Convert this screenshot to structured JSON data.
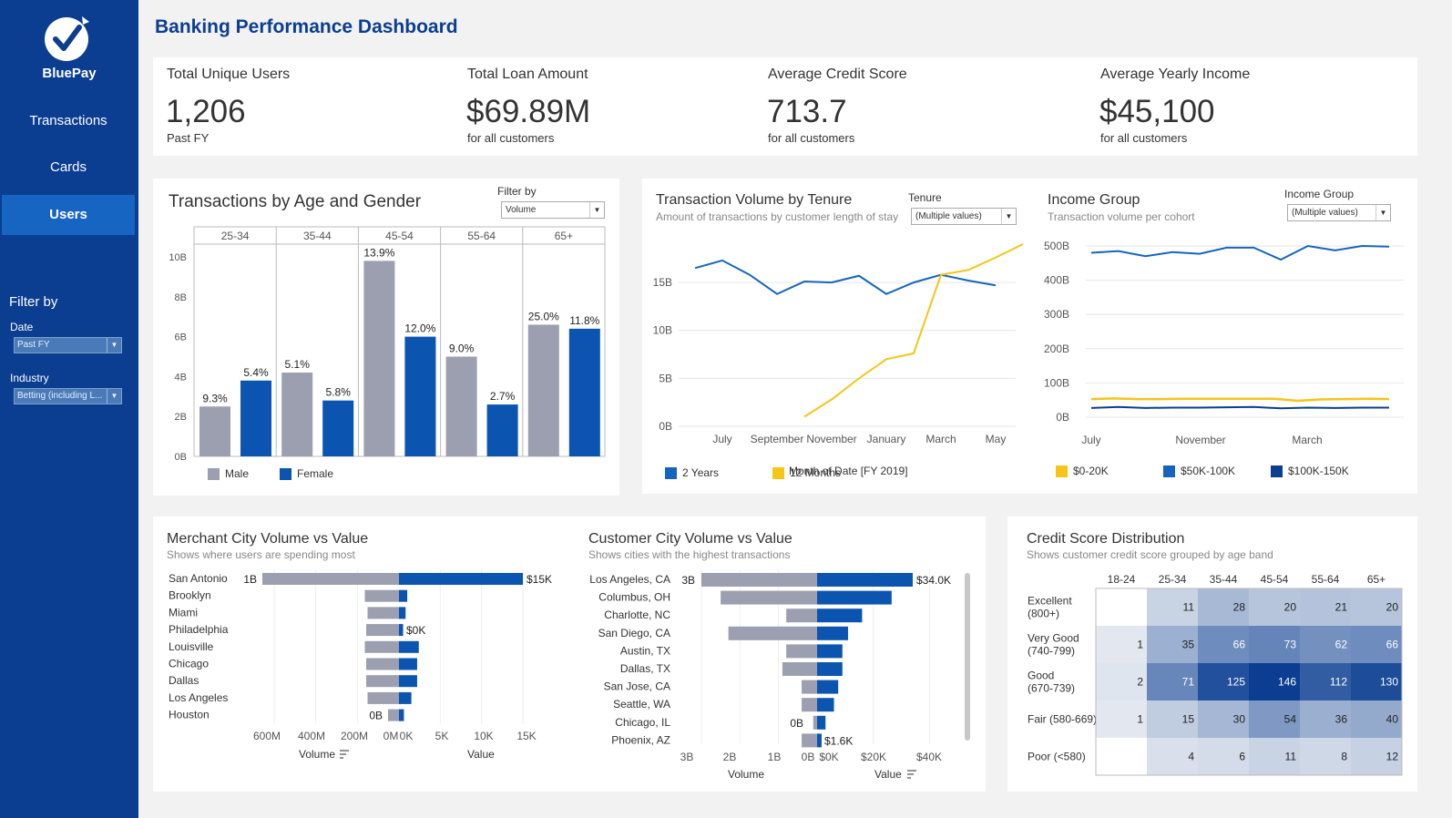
{
  "sidebar": {
    "brand": "BluePay",
    "nav": [
      "Transactions",
      "Cards",
      "Users"
    ],
    "filter_title": "Filter by",
    "date_label": "Date",
    "date_value": "Past FY",
    "industry_label": "Industry",
    "industry_value": "Betting (including L..."
  },
  "page": {
    "title": "Banking Performance Dashboard"
  },
  "kpis": [
    {
      "label": "Total Unique Users",
      "value": "1,206",
      "sub": "Past FY"
    },
    {
      "label": "Total Loan Amount",
      "value": "$69.89M",
      "sub": "for all customers"
    },
    {
      "label": "Average Credit Score",
      "value": "713.7",
      "sub": "for all customers"
    },
    {
      "label": "Average Yearly Income",
      "value": "$45,100",
      "sub": "for all customers"
    }
  ],
  "colors": {
    "male": "#9b9fb0",
    "female": "#0b55b0",
    "tenure_2y": "#1565c0",
    "tenure_12m": "#f5c518",
    "inc_0_20": "#f5c518",
    "inc_50_100": "#1565c0",
    "inc_100_150": "#0b3d91"
  },
  "age_gender": {
    "title": "Transactions by Age and Gender",
    "filter_label": "Filter by",
    "filter_value": "Volume",
    "legend": [
      "Male",
      "Female"
    ]
  },
  "tenure": {
    "title": "Transaction Volume by Tenure",
    "subtitle": "Amount of transactions by customer length of stay",
    "filter_label": "Tenure",
    "filter_value": "(Multiple values)",
    "x_title": "Month of Date [FY 2019]",
    "legend": [
      "2 Years",
      "12 Months"
    ]
  },
  "income": {
    "title": "Income Group",
    "subtitle": "Transaction volume per cohort",
    "filter_label": "Income Group",
    "filter_value": "(Multiple values)",
    "legend": [
      "$0-20K",
      "$50K-100K",
      "$100K-150K"
    ]
  },
  "merchant": {
    "title": "Merchant City Volume vs Value",
    "subtitle": "Shows where users are spending most",
    "axis_left": "Volume",
    "axis_right": "Value"
  },
  "customer": {
    "title": "Customer City Volume vs Value",
    "subtitle": "Shows cities with the highest transactions",
    "axis_left": "Volume",
    "axis_right": "Value"
  },
  "credit": {
    "title": "Credit Score Distribution",
    "subtitle": "Shows customer credit score grouped by age band"
  },
  "chart_data": [
    {
      "type": "bar",
      "title": "Transactions by Age and Gender",
      "panels": [
        "25-34",
        "35-44",
        "45-54",
        "55-64",
        "65+"
      ],
      "series": [
        {
          "name": "Male",
          "values": [
            2.5,
            4.2,
            9.8,
            5.0,
            6.6
          ],
          "labels": [
            "9.3%",
            "5.1%",
            "13.9%",
            "9.0%",
            "25.0%"
          ]
        },
        {
          "name": "Female",
          "values": [
            3.8,
            2.8,
            6.0,
            2.6,
            6.4
          ],
          "labels": [
            "5.4%",
            "5.8%",
            "12.0%",
            "2.7%",
            "11.8%"
          ]
        }
      ],
      "y_ticks": [
        "0B",
        "2B",
        "4B",
        "6B",
        "8B",
        "10B"
      ],
      "ylim": [
        0,
        11
      ],
      "legend": "bottom"
    },
    {
      "type": "line",
      "title": "Transaction Volume by Tenure",
      "x": [
        "Jun",
        "July",
        "Aug",
        "September",
        "Oct",
        "November",
        "Dec",
        "January",
        "Feb",
        "March",
        "Apr",
        "May",
        "Jun"
      ],
      "x_ticks": [
        "July",
        "September",
        "November",
        "January",
        "March",
        "May"
      ],
      "series": [
        {
          "name": "2 Years",
          "values": [
            16.5,
            17.3,
            15.8,
            13.8,
            15.1,
            15.0,
            15.7,
            13.8,
            15.0,
            15.8,
            15.2,
            14.7,
            null
          ]
        },
        {
          "name": "12 Months",
          "values": [
            null,
            null,
            null,
            null,
            1.0,
            2.8,
            5.0,
            7.0,
            7.6,
            15.8,
            16.3,
            17.6,
            19.0
          ]
        }
      ],
      "y_ticks": [
        "0B",
        "5B",
        "10B",
        "15B"
      ],
      "ylim": [
        0,
        19
      ],
      "legend": "bottom"
    },
    {
      "type": "line",
      "title": "Income Group",
      "x_ticks": [
        "July",
        "November",
        "March"
      ],
      "series": [
        {
          "name": "$0-20K",
          "values": [
            53,
            55,
            53,
            53,
            54,
            54,
            54,
            54,
            54,
            48,
            52,
            53,
            54,
            53
          ]
        },
        {
          "name": "$50K-100K",
          "values": [
            480,
            485,
            470,
            482,
            477,
            495,
            495,
            460,
            500,
            487,
            500,
            498
          ]
        },
        {
          "name": "$100K-150K",
          "values": [
            27,
            30,
            27,
            28,
            28,
            29,
            30,
            26,
            28,
            27,
            28,
            28
          ]
        }
      ],
      "y_ticks": [
        "0B",
        "100B",
        "200B",
        "300B",
        "400B",
        "500B"
      ],
      "ylim": [
        0,
        530
      ],
      "legend": "bottom"
    },
    {
      "type": "bar",
      "title": "Merchant City Volume vs Value",
      "categories": [
        "San Antonio",
        "Brooklyn",
        "Miami",
        "Philadelphia",
        "Louisville",
        "Chicago",
        "Dallas",
        "Los Angeles",
        "Houston"
      ],
      "series": [
        {
          "name": "Volume",
          "values": [
            1000,
            250,
            230,
            240,
            250,
            240,
            240,
            230,
            80
          ]
        },
        {
          "name": "Value",
          "values": [
            15000,
            1000,
            800,
            500,
            2400,
            2200,
            2200,
            1500,
            600
          ]
        }
      ],
      "bar_labels": {
        "volume_top": "1B",
        "volume_bottom": "0B",
        "value_top": "$15K",
        "value_mid": "$0K"
      },
      "volume_ticks": [
        "600M",
        "400M",
        "200M",
        "0M"
      ],
      "value_ticks": [
        "0K",
        "5K",
        "10K",
        "15K"
      ]
    },
    {
      "type": "bar",
      "title": "Customer City Volume vs Value",
      "categories": [
        "Los Angeles, CA",
        "Columbus, OH",
        "Charlotte, NC",
        "San Diego, CA",
        "Austin, TX",
        "Dallas, TX",
        "San Jose, CA",
        "Seattle, WA",
        "Chicago, IL",
        "Phoenix, AZ"
      ],
      "series": [
        {
          "name": "Volume",
          "values": [
            3.0,
            2.5,
            0.8,
            2.3,
            0.8,
            0.9,
            0.4,
            0.4,
            0.1,
            0.4
          ]
        },
        {
          "name": "Value",
          "values": [
            34000,
            26500,
            16000,
            11000,
            9000,
            9000,
            7500,
            6000,
            3000,
            1600
          ]
        }
      ],
      "bar_labels": {
        "volume_top": "3B",
        "volume_bottom": "0B",
        "value_top": "$34.0K",
        "value_bottom": "$1.6K"
      },
      "volume_ticks": [
        "3B",
        "2B",
        "1B",
        "0B"
      ],
      "value_ticks": [
        "$0K",
        "$20K",
        "$40K"
      ]
    },
    {
      "type": "heatmap",
      "title": "Credit Score Distribution",
      "columns": [
        "18-24",
        "25-34",
        "35-44",
        "45-54",
        "55-64",
        "65+"
      ],
      "rows": [
        "Excellent (800+)",
        "Very Good (740-799)",
        "Good (670-739)",
        "Fair (580-669)",
        "Poor (<580)"
      ],
      "row_lines": [
        [
          "Excellent",
          "(800+)"
        ],
        [
          "Very Good",
          "(740-799)"
        ],
        [
          "Good",
          "(670-739)"
        ],
        [
          "Fair (580-669)"
        ],
        [
          "Poor (<580)"
        ]
      ],
      "values": [
        [
          null,
          11,
          28,
          20,
          21,
          20
        ],
        [
          1,
          35,
          66,
          73,
          62,
          66
        ],
        [
          2,
          71,
          125,
          146,
          112,
          130
        ],
        [
          1,
          15,
          30,
          54,
          36,
          40
        ],
        [
          null,
          4,
          6,
          11,
          8,
          12
        ]
      ]
    }
  ]
}
